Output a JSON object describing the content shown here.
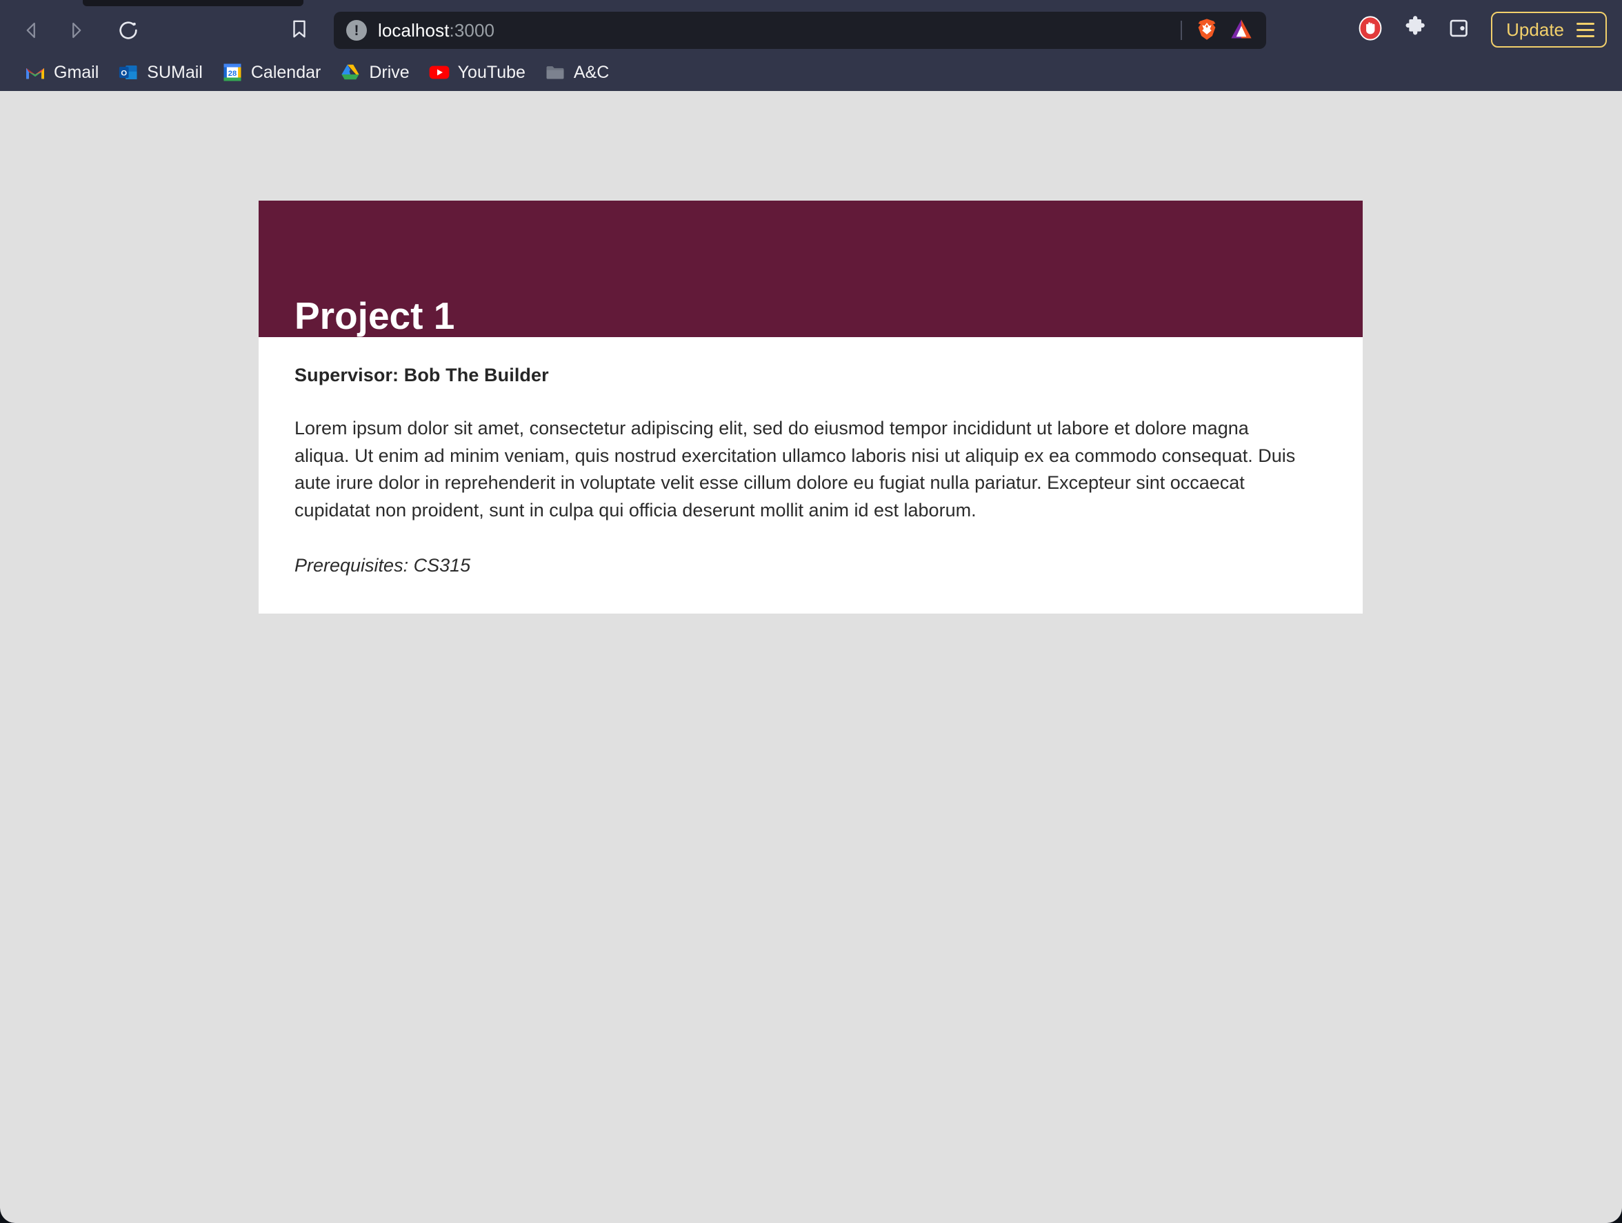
{
  "browser": {
    "name": "brave-browser",
    "nav": {
      "back_icon": "back-arrow-icon",
      "forward_icon": "forward-arrow-icon",
      "reload_icon": "reload-icon",
      "bookmark_icon": "bookmark-icon"
    },
    "omnibox": {
      "url_host": "localhost",
      "url_port": ":3000",
      "site_info_icon": "info-circle-icon",
      "site_info_glyph": "!",
      "shields_icon": "brave-lion-shields-icon",
      "rewards_icon": "brave-bat-triangle-icon"
    },
    "toolbar_right": {
      "adblock_icon": "stop-hand-adblock-icon",
      "extensions_icon": "extensions-puzzle-icon",
      "wallet_icon": "brave-wallet-icon",
      "update_label": "Update",
      "menu_icon": "hamburger-menu-icon"
    },
    "bookmarks": [
      {
        "label": "Gmail",
        "icon": "gmail-icon"
      },
      {
        "label": "SUMail",
        "icon": "outlook-icon"
      },
      {
        "label": "Calendar",
        "icon": "google-calendar-icon",
        "day": "28"
      },
      {
        "label": "Drive",
        "icon": "google-drive-icon"
      },
      {
        "label": "YouTube",
        "icon": "youtube-icon"
      },
      {
        "label": "A&C",
        "icon": "folder-icon"
      }
    ]
  },
  "page": {
    "background_color": "#e0e0e0",
    "card": {
      "header_color": "#621a39",
      "title": "Project 1",
      "supervisor": "Supervisor: Bob The Builder",
      "description": "Lorem ipsum dolor sit amet, consectetur adipiscing elit, sed do eiusmod tempor incididunt ut labore et dolore magna aliqua. Ut enim ad minim veniam, quis nostrud exercitation ullamco laboris nisi ut aliquip ex ea commodo consequat. Duis aute irure dolor in reprehenderit in voluptate velit esse cillum dolore eu fugiat nulla pariatur. Excepteur sint occaecat cupidatat non proident, sunt in culpa qui officia deserunt mollit anim id est laborum.",
      "prerequisites": "Prerequisites: CS315"
    }
  }
}
